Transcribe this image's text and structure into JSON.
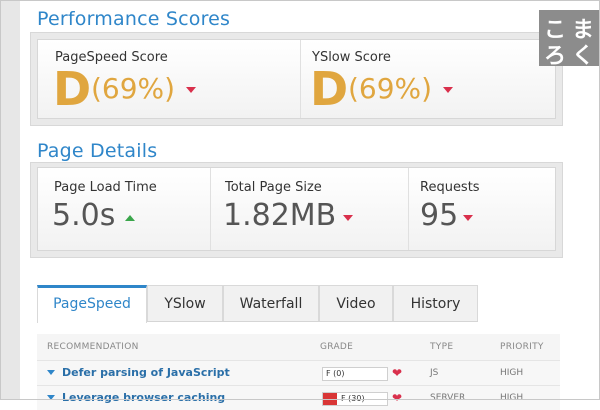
{
  "performance": {
    "title": "Performance Scores",
    "pagespeed": {
      "label": "PageSpeed Score",
      "grade": "D",
      "percent": "(69%)"
    },
    "yslow": {
      "label": "YSlow Score",
      "grade": "D",
      "percent": "(69%)"
    }
  },
  "details": {
    "title": "Page Details",
    "load_time": {
      "label": "Page Load Time",
      "value": "5.0s"
    },
    "page_size": {
      "label": "Total Page Size",
      "value": "1.82MB"
    },
    "requests": {
      "label": "Requests",
      "value": "95"
    }
  },
  "tabs": [
    "PageSpeed",
    "YSlow",
    "Waterfall",
    "Video",
    "History"
  ],
  "table": {
    "headers": {
      "recommendation": "RECOMMENDATION",
      "grade": "GRADE",
      "type": "TYPE",
      "priority": "PRIORITY"
    },
    "rows": [
      {
        "recommendation": "Defer parsing of JavaScript",
        "grade": "F (0)",
        "type": "JS",
        "priority": "HIGH"
      },
      {
        "recommendation": "Leverage browser caching",
        "grade": "F (30)",
        "type": "SERVER",
        "priority": "HIGH"
      }
    ]
  },
  "badge": {
    "chars": [
      "こ",
      "ま",
      "ろ",
      "く"
    ]
  },
  "colors": {
    "accent": "#2f86c9",
    "grade_orange": "#e0a63f",
    "down_red": "#d9304c",
    "up_green": "#3aa64b"
  }
}
